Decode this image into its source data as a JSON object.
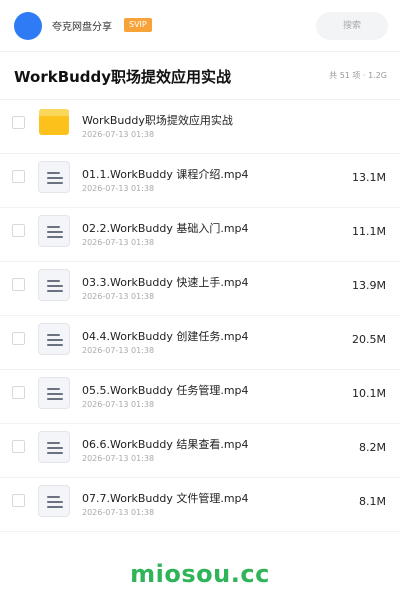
{
  "header": {
    "share_name": "夸克网盘分享",
    "vip_badge": "SVIP",
    "search_placeholder": "搜索"
  },
  "folder": {
    "title": "WorkBuddy职场提效应用实战",
    "meta": "共 51 项 · 1.2G"
  },
  "files": [
    {
      "name": "WorkBuddy职场提效应用实战",
      "date": "2026-07-13 01:38",
      "size": "",
      "type": "folder-icon"
    },
    {
      "name": "01.1.WorkBuddy 课程介绍.mp4",
      "date": "2026-07-13 01:38",
      "size": "13.1M",
      "type": "file-icon"
    },
    {
      "name": "02.2.WorkBuddy 基础入门.mp4",
      "date": "2026-07-13 01:38",
      "size": "11.1M",
      "type": "file-icon"
    },
    {
      "name": "03.3.WorkBuddy 快速上手.mp4",
      "date": "2026-07-13 01:38",
      "size": "13.9M",
      "type": "file-icon"
    },
    {
      "name": "04.4.WorkBuddy 创建任务.mp4",
      "date": "2026-07-13 01:38",
      "size": "20.5M",
      "type": "file-icon"
    },
    {
      "name": "05.5.WorkBuddy 任务管理.mp4",
      "date": "2026-07-13 01:38",
      "size": "10.1M",
      "type": "file-icon"
    },
    {
      "name": "06.6.WorkBuddy 结果查看.mp4",
      "date": "2026-07-13 01:38",
      "size": "8.2M",
      "type": "file-icon"
    },
    {
      "name": "07.7.WorkBuddy 文件管理.mp4",
      "date": "2026-07-13 01:38",
      "size": "8.1M",
      "type": "file-icon"
    }
  ],
  "watermark": "miosou.cc",
  "colors": {
    "accent_blue": "#2f7bf5",
    "vip_orange": "#f7a33a",
    "folder_yellow": "#fcc21b",
    "watermark_green": "#2fb45a"
  }
}
